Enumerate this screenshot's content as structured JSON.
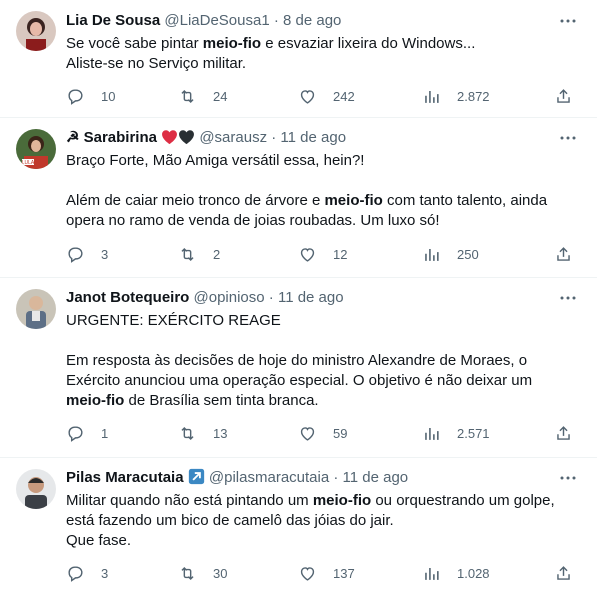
{
  "tweets": [
    {
      "name": "Lia De Sousa",
      "handle": "@LiaDeSousa1",
      "date": "8 de ago",
      "lines": [
        [
          "Se você sabe pintar ",
          "meio-fio",
          " e esvaziar lixeira do Windows..."
        ],
        [
          "Aliste-se no Serviço militar."
        ]
      ],
      "replies": "10",
      "retweets": "24",
      "likes": "242",
      "views": "2.872"
    },
    {
      "name": "☭ Sarabirina",
      "handle": "@sarausz",
      "date": "11 de ago",
      "lines": [
        [
          "Braço Forte, Mão Amiga versátil essa, hein?!"
        ],
        [
          ""
        ],
        [
          "Além de caiar meio tronco de árvore e ",
          "meio-fio",
          " com tanto talento, ainda"
        ],
        [
          "opera no ramo de venda de joias roubadas. Um luxo só!"
        ]
      ],
      "replies": "3",
      "retweets": "2",
      "likes": "12",
      "views": "250"
    },
    {
      "name": "Janot Botequeiro",
      "handle": "@opinioso",
      "date": "11 de ago",
      "lines": [
        [
          "URGENTE: EXÉRCITO REAGE"
        ],
        [
          ""
        ],
        [
          "Em resposta às decisões de hoje do ministro Alexandre de Moraes, o"
        ],
        [
          "Exército anunciou uma operação especial. O objetivo é não deixar um"
        ],
        [
          "",
          "meio-fio",
          " de Brasília sem tinta branca."
        ]
      ],
      "replies": "1",
      "retweets": "13",
      "likes": "59",
      "views": "2.571"
    },
    {
      "name": "Pilas Maracutaia",
      "handle": "@pilasmaracutaia",
      "date": "11 de ago",
      "lines": [
        [
          "Militar quando não está pintando um ",
          "meio-fio",
          " ou orquestrando um golpe,"
        ],
        [
          "está fazendo um bico de camelô das jóias do jair."
        ],
        [
          "Que fase."
        ]
      ],
      "replies": "3",
      "retweets": "30",
      "likes": "137",
      "views": "1.028"
    }
  ]
}
